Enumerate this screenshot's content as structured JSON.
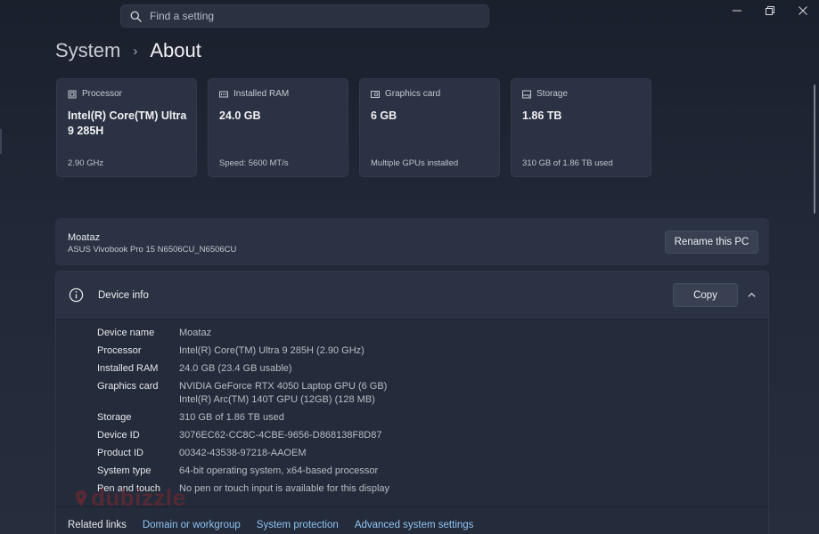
{
  "search": {
    "placeholder": "Find a setting"
  },
  "window_controls": [
    "minimize",
    "maximize",
    "close"
  ],
  "breadcrumb": {
    "parent": "System",
    "separator": "›",
    "current": "About"
  },
  "cards": [
    {
      "icon": "processor-icon",
      "label": "Processor",
      "value": "Intel(R) Core(TM) Ultra 9 285H",
      "detail": "2.90 GHz"
    },
    {
      "icon": "ram-icon",
      "label": "Installed RAM",
      "value": "24.0 GB",
      "detail": "Speed: 5600 MT/s"
    },
    {
      "icon": "graphics-card-icon",
      "label": "Graphics card",
      "value": "6 GB",
      "detail": "Multiple GPUs installed"
    },
    {
      "icon": "storage-icon",
      "label": "Storage",
      "value": "1.86 TB",
      "detail": "310 GB of 1.86 TB used"
    }
  ],
  "pc": {
    "name": "Moataz",
    "model": "ASUS Vivobook Pro 15 N6506CU_N6506CU",
    "rename_label": "Rename this PC"
  },
  "device_info": {
    "title": "Device info",
    "copy_label": "Copy",
    "rows": [
      {
        "label": "Device name",
        "value": "Moataz"
      },
      {
        "label": "Processor",
        "value": "Intel(R) Core(TM) Ultra 9 285H (2.90 GHz)"
      },
      {
        "label": "Installed RAM",
        "value": "24.0 GB (23.4 GB usable)"
      },
      {
        "label": "Graphics card",
        "value": "NVIDIA GeForce RTX 4050 Laptop GPU (6 GB)",
        "value2": "Intel(R) Arc(TM) 140T GPU (12GB) (128 MB)"
      },
      {
        "label": "Storage",
        "value": "310 GB of 1.86 TB used"
      },
      {
        "label": "Device ID",
        "value": "3076EC62-CC8C-4CBE-9656-D868138F8D87"
      },
      {
        "label": "Product ID",
        "value": "00342-43538-97218-AAOEM"
      },
      {
        "label": "System type",
        "value": "64-bit operating system, x64-based processor"
      },
      {
        "label": "Pen and touch",
        "value": "No pen or touch input is available for this display"
      }
    ]
  },
  "related": {
    "title": "Related links",
    "links": [
      "Domain or workgroup",
      "System protection",
      "Advanced system settings"
    ]
  },
  "watermark": {
    "text": "dubizzle"
  },
  "colors": {
    "accent_link": "#8fc3f2",
    "card_bg": "#2b3243",
    "page_bg": "#1d2330"
  }
}
